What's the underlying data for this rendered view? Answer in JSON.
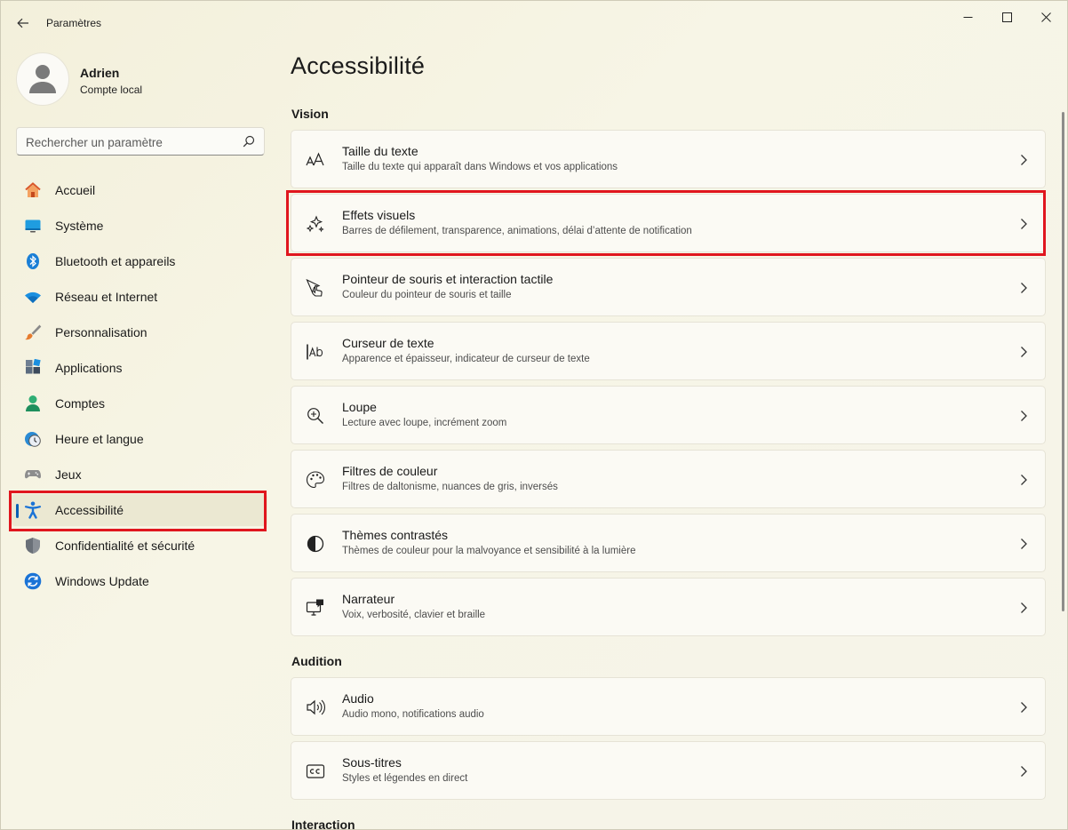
{
  "window": {
    "title": "Paramètres"
  },
  "profile": {
    "name": "Adrien",
    "account_type": "Compte local"
  },
  "search": {
    "placeholder": "Rechercher un paramètre"
  },
  "nav": {
    "items": [
      {
        "label": "Accueil",
        "icon": "home-icon"
      },
      {
        "label": "Système",
        "icon": "display-icon"
      },
      {
        "label": "Bluetooth et appareils",
        "icon": "bluetooth-icon"
      },
      {
        "label": "Réseau et Internet",
        "icon": "wifi-icon"
      },
      {
        "label": "Personnalisation",
        "icon": "brush-icon"
      },
      {
        "label": "Applications",
        "icon": "apps-icon"
      },
      {
        "label": "Comptes",
        "icon": "person-icon"
      },
      {
        "label": "Heure et langue",
        "icon": "clock-globe-icon"
      },
      {
        "label": "Jeux",
        "icon": "gamepad-icon"
      },
      {
        "label": "Accessibilité",
        "icon": "accessibility-icon",
        "active": true
      },
      {
        "label": "Confidentialité et sécurité",
        "icon": "shield-icon"
      },
      {
        "label": "Windows Update",
        "icon": "update-icon"
      }
    ]
  },
  "main": {
    "title": "Accessibilité",
    "sections": [
      {
        "label": "Vision",
        "cards": [
          {
            "title": "Taille du texte",
            "desc": "Taille du texte qui apparaît dans Windows et vos applications",
            "icon": "text-size-icon"
          },
          {
            "title": "Effets visuels",
            "desc": "Barres de défilement, transparence, animations, délai d’attente de notification",
            "icon": "sparkle-icon",
            "highlighted": true
          },
          {
            "title": "Pointeur de souris et interaction tactile",
            "desc": "Couleur du pointeur de souris et taille",
            "icon": "pointer-touch-icon"
          },
          {
            "title": "Curseur de texte",
            "desc": "Apparence et épaisseur, indicateur de curseur de texte",
            "icon": "text-cursor-icon"
          },
          {
            "title": "Loupe",
            "desc": "Lecture avec loupe, incrément zoom",
            "icon": "magnifier-icon"
          },
          {
            "title": "Filtres de couleur",
            "desc": "Filtres de daltonisme, nuances de gris, inversés",
            "icon": "palette-icon"
          },
          {
            "title": "Thèmes contrastés",
            "desc": "Thèmes de couleur pour la malvoyance et sensibilité à la lumière",
            "icon": "contrast-icon"
          },
          {
            "title": "Narrateur",
            "desc": "Voix, verbosité, clavier et braille",
            "icon": "narrator-icon"
          }
        ]
      },
      {
        "label": "Audition",
        "cards": [
          {
            "title": "Audio",
            "desc": "Audio mono, notifications audio",
            "icon": "speaker-icon"
          },
          {
            "title": "Sous-titres",
            "desc": "Styles et légendes en direct",
            "icon": "captions-icon"
          }
        ]
      },
      {
        "label": "Interaction",
        "cards": []
      }
    ]
  },
  "colors": {
    "accent": "#0a5fb4",
    "highlight": "#e0161e"
  }
}
